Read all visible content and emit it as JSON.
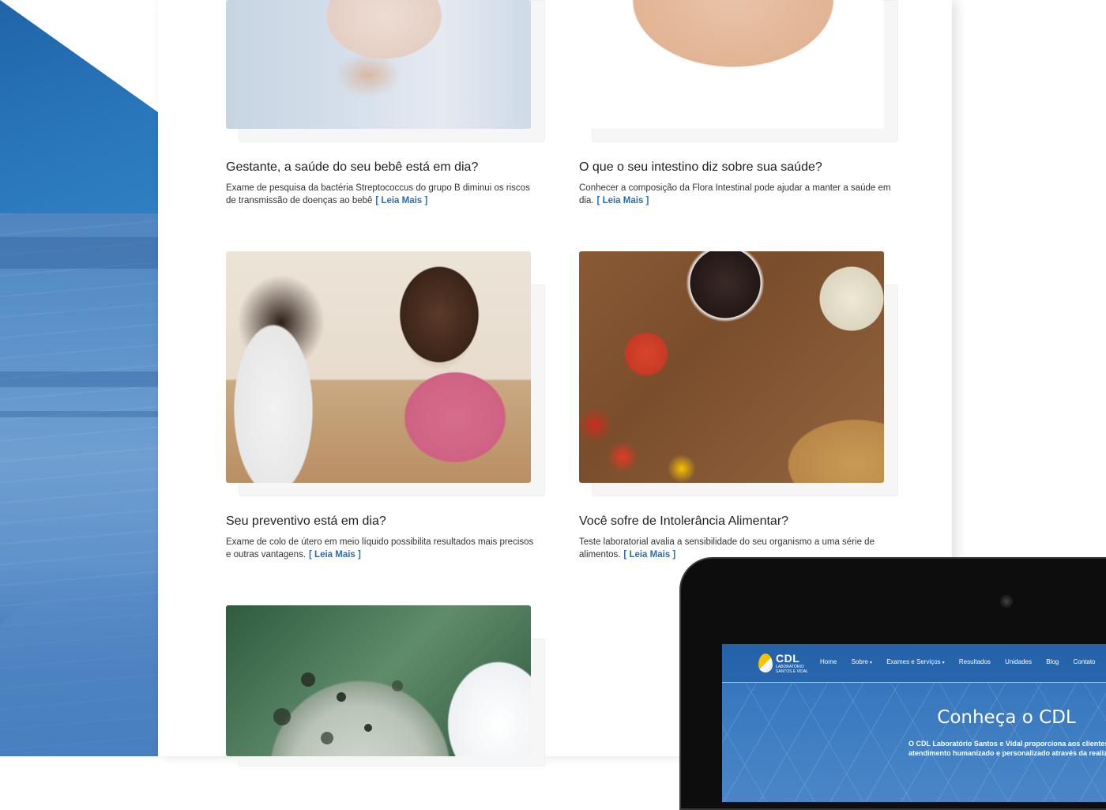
{
  "articles": [
    {
      "title": "Gestante, a saúde do seu bebê está em dia?",
      "text": "Exame de pesquisa da bactéria Streptococcus do grupo B diminui os riscos de transmissão de doenças ao bebê",
      "link": "[ Leia Mais ]"
    },
    {
      "title": "O que o seu intestino diz sobre sua saúde?",
      "text": "Conhecer a composição da Flora Intestinal pode ajudar a manter a saúde em dia.",
      "link": "[ Leia Mais ]"
    },
    {
      "title": "Seu preventivo está em dia?",
      "text": "Exame de colo de útero em meio líquido possibilita resultados mais precisos e outras vantagens.",
      "link": "[ Leia Mais ]"
    },
    {
      "title": "Você sofre de Intolerância Alimentar?",
      "text": "Teste laboratorial avalia a sensibilidade do seu organismo a uma série de alimentos.",
      "link": "[ Leia Mais ]"
    }
  ],
  "tablet": {
    "logo_name": "CDL",
    "logo_sub_1": "LABORATÓRIO",
    "logo_sub_2": "SANTOS E VIDAL",
    "nav": [
      "Home",
      "Sobre",
      "Exames e Serviços",
      "Resultados",
      "Unidades",
      "Blog",
      "Contato"
    ],
    "hero_title": "Conheça o CDL",
    "hero_text_1": "O CDL Laboratório Santos e Vidal proporciona aos clientes um",
    "hero_text_2": "atendimento humanizado e personalizado através da realização"
  },
  "colors": {
    "brand_blue": "#2c6cb3",
    "logo_yellow": "#f5c400"
  }
}
